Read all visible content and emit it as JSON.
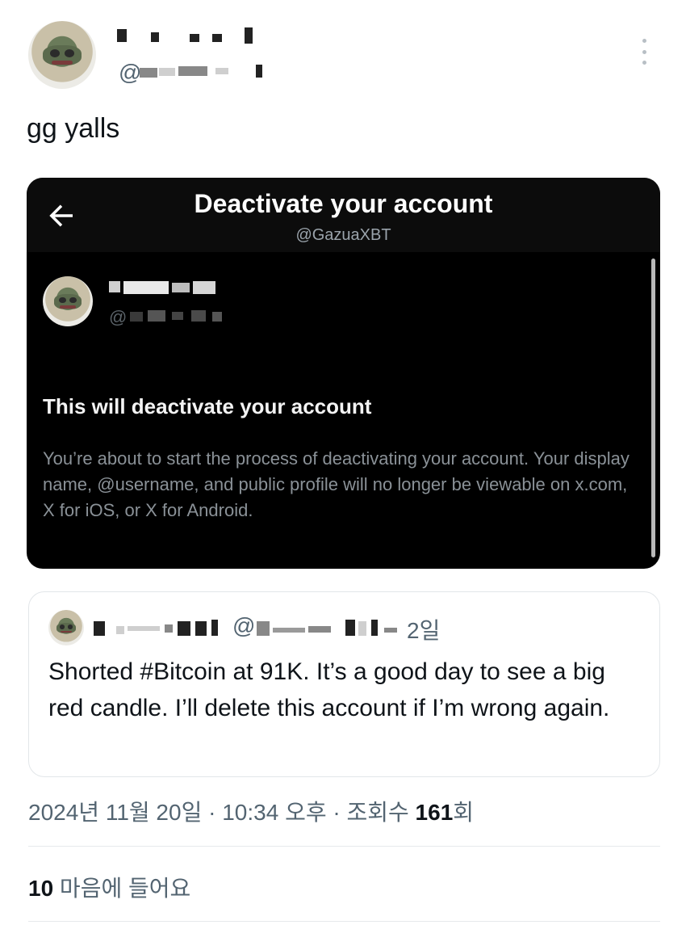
{
  "post": {
    "author_handle_prefix": "@",
    "text": "gg yalls",
    "more_icon": "more-vertical-icon"
  },
  "embedded_screenshot": {
    "title": "Deactivate your account",
    "handle": "@GazuaXBT",
    "back_icon": "arrow-left-icon",
    "profile_handle_prefix": "@",
    "warning_heading": "This will deactivate your account",
    "warning_body": "You’re about to start the process of deactivating your account. Your display name, @username, and public profile will no longer be viewable on x.com, X for iOS, or X for Android."
  },
  "quote": {
    "handle_prefix": "@",
    "time": "2일",
    "text": "Shorted #Bitcoin at 91K. It’s a good day to see a big red candle. I’ll delete this account if I’m wrong again."
  },
  "meta": {
    "datetime": "2024년 11월 20일 · 10:34 오후 · 조회수 ",
    "views": "161",
    "views_suffix": "회"
  },
  "likes": {
    "count": "10",
    "label": " 마음에 들어요"
  },
  "colors": {
    "text_primary": "#0f1419",
    "text_secondary": "#536471",
    "dark_card_bg": "#000000"
  }
}
